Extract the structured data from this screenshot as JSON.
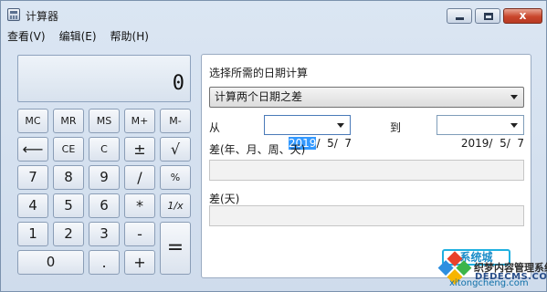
{
  "window": {
    "title": "计算器",
    "close_symbol": "x"
  },
  "menu": {
    "items": [
      "查看(V)",
      "编辑(E)",
      "帮助(H)"
    ]
  },
  "calculator": {
    "display_value": "0",
    "keys": {
      "mc": "MC",
      "mr": "MR",
      "ms": "MS",
      "mplus": "M+",
      "mminus": "M-",
      "backspace": "⟵",
      "ce": "CE",
      "c": "C",
      "plusminus": "±",
      "sqrt": "√",
      "n7": "7",
      "n8": "8",
      "n9": "9",
      "divide": "/",
      "percent": "%",
      "n4": "4",
      "n5": "5",
      "n6": "6",
      "multiply": "*",
      "reciprocal": "1/x",
      "n1": "1",
      "n2": "2",
      "n3": "3",
      "minus": "-",
      "equals": "=",
      "n0": "0",
      "decimal": ".",
      "plus": "+"
    }
  },
  "date_panel": {
    "heading": "选择所需的日期计算",
    "mode_selected": "计算两个日期之差",
    "from_label": "从",
    "from_year": "2019",
    "from_rest": "/  5/  7",
    "to_label": "到",
    "to_date": "2019/  5/  7",
    "diff_label": "差(年、月、周、天)",
    "diff_days_label": "差(天)"
  },
  "watermark": {
    "logo_text": "系统城",
    "brand": "织梦内容管理系统",
    "domain": "DEDECMS.COM",
    "site": "xitongcheng.com"
  }
}
